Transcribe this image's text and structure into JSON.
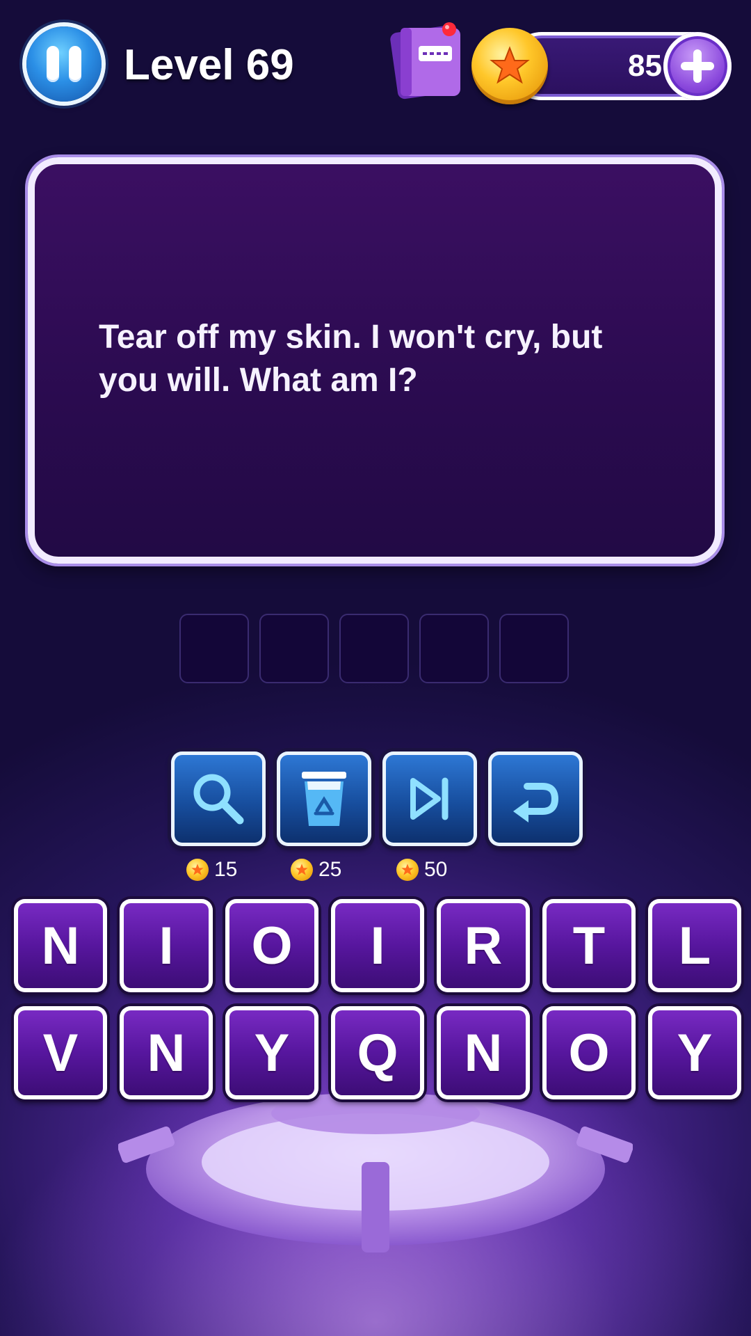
{
  "header": {
    "level_label": "Level 69",
    "coins": "85"
  },
  "riddle": {
    "text": "Tear off my skin. I won't cry, but you will. What am I?"
  },
  "answer": {
    "slots": 5
  },
  "tools": [
    {
      "name": "magnifier",
      "icon": "magnifier-icon",
      "cost": "15"
    },
    {
      "name": "trash",
      "icon": "recycle-bin-icon",
      "cost": "25"
    },
    {
      "name": "skip",
      "icon": "skip-forward-icon",
      "cost": "50"
    },
    {
      "name": "undo",
      "icon": "undo-icon",
      "cost": ""
    }
  ],
  "letters": {
    "row1": [
      "N",
      "I",
      "O",
      "I",
      "R",
      "T",
      "L"
    ],
    "row2": [
      "V",
      "N",
      "Y",
      "Q",
      "N",
      "O",
      "Y"
    ]
  },
  "colors": {
    "tile_purple": "#57169e",
    "tool_blue": "#174e9e",
    "coin_gold": "#ffc72a"
  }
}
